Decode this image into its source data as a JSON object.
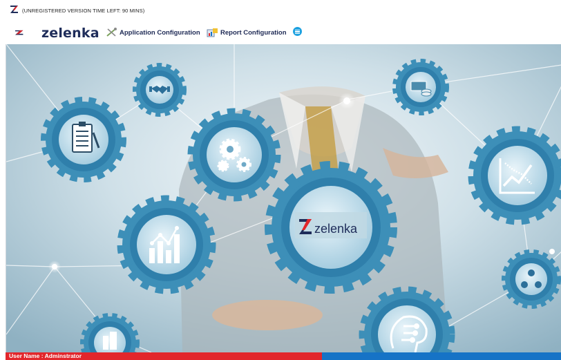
{
  "window": {
    "title": "(UNREGISTERED VERSION TIME LEFT: 90  MINS)",
    "app_icon": "zelenka-z-icon"
  },
  "toolbar": {
    "logo_text": "zelenka",
    "items": [
      {
        "label": "Application Configuration",
        "icon": "tools-icon"
      },
      {
        "label": "Report Configuration",
        "icon": "report-icon"
      }
    ],
    "menu_icon": "hamburger-menu-icon"
  },
  "hero": {
    "center_logo_text": "zelenka",
    "gear_icons": [
      "handshake-icon",
      "clipboard-icon",
      "cogs-icon",
      "money-icon",
      "trend-chart-icon",
      "bar-chart-icon",
      "brain-circuit-icon",
      "team-icon",
      "building-icon"
    ]
  },
  "status": {
    "user_text": "User Name : Adminstrator"
  },
  "colors": {
    "brand_red": "#e2262b",
    "brand_navy": "#1f2d5a",
    "status_blue": "#1673c6",
    "gear_blue": "#3d8fb8"
  }
}
